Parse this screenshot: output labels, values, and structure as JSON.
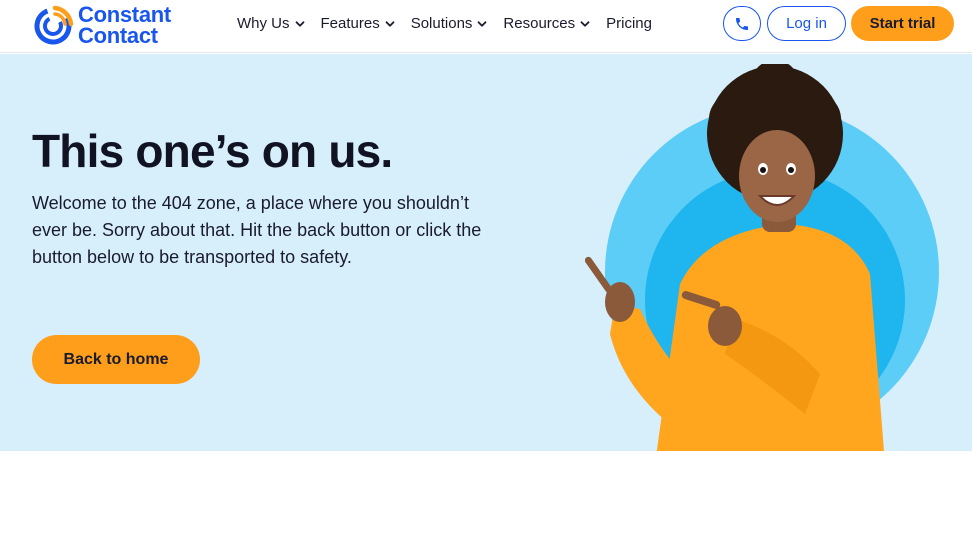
{
  "brand": {
    "line1": "Constant",
    "line2": "Contact",
    "color": "#1856ed",
    "accent": "#ff9e1b"
  },
  "nav": {
    "items": [
      {
        "label": "Why Us",
        "has_dropdown": true
      },
      {
        "label": "Features",
        "has_dropdown": true
      },
      {
        "label": "Solutions",
        "has_dropdown": true
      },
      {
        "label": "Resources",
        "has_dropdown": true
      },
      {
        "label": "Pricing",
        "has_dropdown": false
      }
    ]
  },
  "header_actions": {
    "phone_icon": "phone-icon",
    "login_label": "Log in",
    "trial_label": "Start trial"
  },
  "hero": {
    "title": "This one’s on us.",
    "body": "Welcome to the 404 zone, a place where you shouldn’t ever be. Sorry about that. Hit the back button or click the button below to be transported to safety.",
    "button_label": "Back to home",
    "background": "#d6effa"
  }
}
